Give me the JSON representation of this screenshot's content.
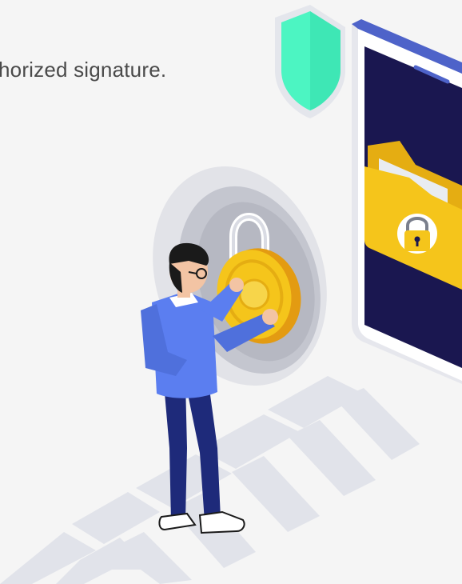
{
  "caption": {
    "text": "horized signature."
  },
  "illustration": {
    "icons": {
      "shield": "shield-icon",
      "folder": "folder-icon",
      "padlock": "padlock-icon",
      "coin": "coin-icon",
      "person": "person-figure",
      "arrows": "chevron-arrows"
    },
    "colors": {
      "background": "#f5f5f5",
      "shield": "#4cf5c2",
      "phone_frame": "#ffffff",
      "phone_screen": "#1a1750",
      "phone_top_bar": "#4e63c9",
      "folder": "#f5c51b",
      "coin": "#f5c51b",
      "shirt": "#5b7ef0",
      "pants": "#1e2a7a",
      "hair": "#1a1a1a",
      "skin": "#f3c4a4",
      "arrows": "#e1e3ea"
    }
  }
}
